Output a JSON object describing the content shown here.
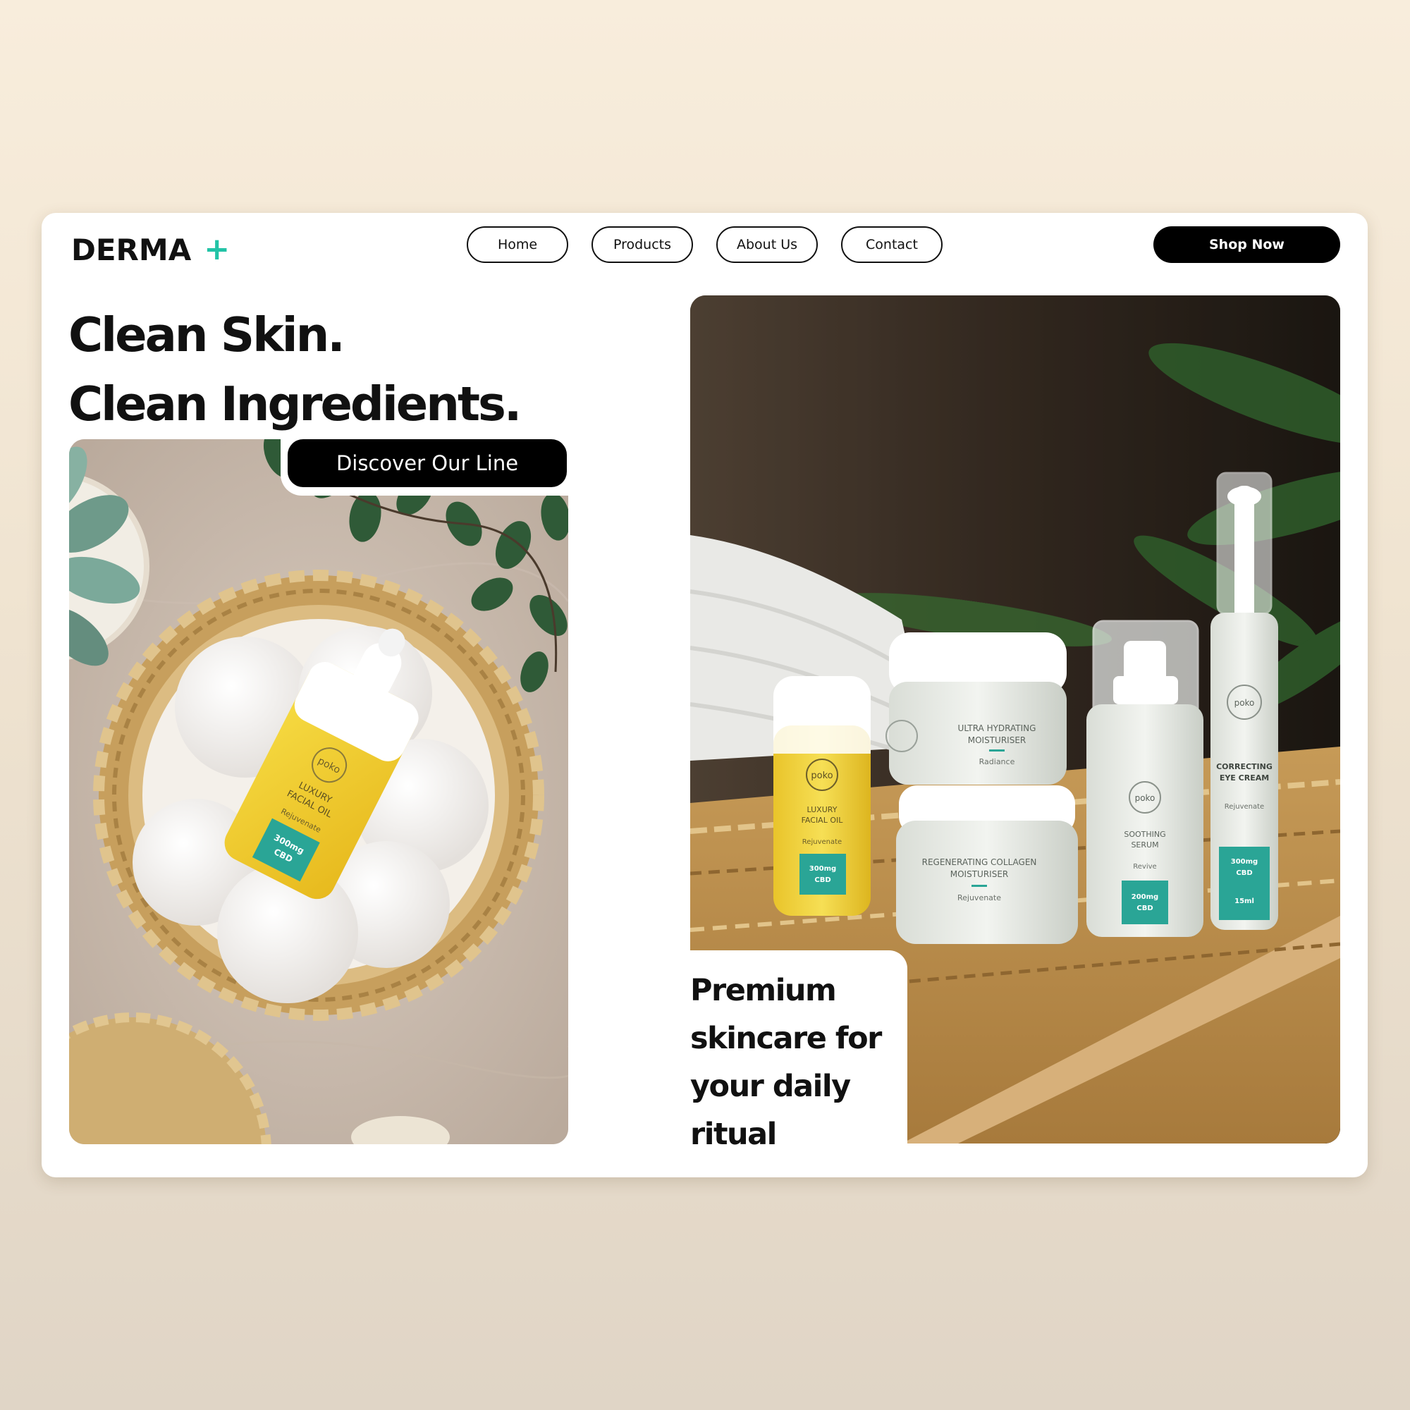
{
  "brand": {
    "name": "DERMA",
    "plus": "+",
    "accent": "#22c3a6"
  },
  "nav": {
    "items": [
      {
        "label": "Home"
      },
      {
        "label": "Products"
      },
      {
        "label": "About Us"
      },
      {
        "label": "Contact"
      }
    ]
  },
  "cta": {
    "shop_label": "Shop Now"
  },
  "hero": {
    "headline_line1": "Clean Skin.",
    "headline_line2": "Clean Ingredients.",
    "discover_label": "Discover Our Line",
    "tagline_line1": "Premium",
    "tagline_line2": "skincare for",
    "tagline_line3": "your daily",
    "tagline_line4": "ritual"
  },
  "products": {
    "brand_mark": "poko",
    "oil": {
      "name1": "LUXURY",
      "name2": "FACIAL OIL",
      "variant": "Rejuvenate",
      "dose1": "300mg",
      "dose2": "CBD"
    },
    "moisturiser": {
      "name1": "ULTRA HYDRATING",
      "name2": "MOISTURISER",
      "variant": "Radiance"
    },
    "collagen": {
      "name1": "REGENERATING COLLAGEN",
      "name2": "MOISTURISER",
      "variant": "Rejuvenate"
    },
    "serum": {
      "name1": "SOOTHING",
      "name2": "SERUM",
      "variant": "Revive",
      "dose1": "200mg",
      "dose2": "CBD"
    },
    "eye": {
      "name1": "CORRECTING",
      "name2": "EYE CREAM",
      "variant": "Rejuvenate",
      "dose1": "300mg",
      "dose2": "CBD",
      "size": "15ml"
    }
  },
  "colors": {
    "label_teal": "#2aa596",
    "oil_yellow": "#f2cf2a",
    "black": "#000000"
  }
}
